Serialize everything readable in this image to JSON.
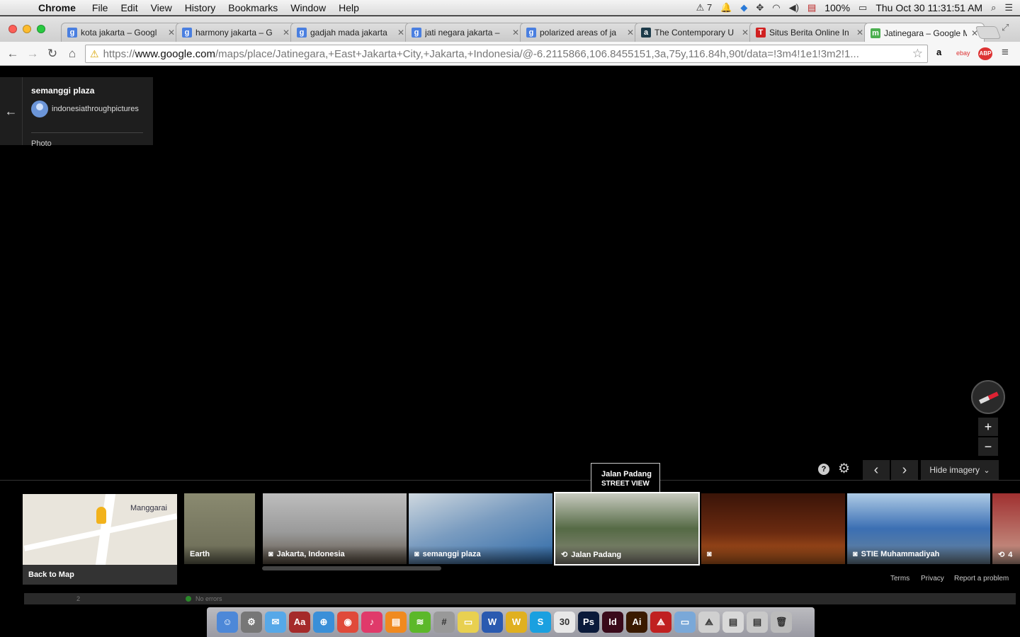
{
  "menubar": {
    "apple": "",
    "app": "Chrome",
    "menus": [
      "File",
      "Edit",
      "View",
      "History",
      "Bookmarks",
      "Window",
      "Help"
    ],
    "adobe_count": "7",
    "battery": "100%",
    "datetime": "Thu Oct 30  11:31:51 AM"
  },
  "tabs": [
    {
      "title": "kota jakarta – Googl",
      "favicon": "g",
      "color": "#4a7fe0"
    },
    {
      "title": "harmony jakarta – G",
      "favicon": "g",
      "color": "#4a7fe0"
    },
    {
      "title": "gadjah mada jakarta",
      "favicon": "g",
      "color": "#4a7fe0"
    },
    {
      "title": "jati negara jakarta –",
      "favicon": "g",
      "color": "#4a7fe0"
    },
    {
      "title": "polarized areas of ja",
      "favicon": "g",
      "color": "#4a7fe0"
    },
    {
      "title": "The Contemporary U",
      "favicon": "a",
      "color": "#1d3b4a"
    },
    {
      "title": "Situs Berita Online In",
      "favicon": "T",
      "color": "#d02020"
    },
    {
      "title": "Jatinegara – Google M",
      "favicon": "m",
      "color": "#4caf50"
    }
  ],
  "address": {
    "scheme": "https://",
    "host": "www.google.com",
    "path": "/maps/place/Jatinegara,+East+Jakarta+City,+Jakarta,+Indonesia/@-6.2115866,106.8455151,3a,75y,116.84h,90t/data=!3m4!1e1!3m2!1..."
  },
  "extensions": {
    "amazon": "a",
    "ebay": "ebay",
    "abp": "ABP"
  },
  "infocard": {
    "title": "semanggi plaza",
    "author": "indonesiathroughpictures",
    "kind": "Photo"
  },
  "controls": {
    "zoom_in": "+",
    "zoom_out": "−",
    "help": "?",
    "settings": "⚙",
    "prev": "‹",
    "next": "›",
    "hide_imagery": "Hide imagery"
  },
  "tooltip": {
    "title": "Jalan Padang",
    "subtitle": "STREET VIEW"
  },
  "mapthumb": {
    "label": "Manggarai",
    "back": "Back to Map"
  },
  "thumbnails": [
    {
      "caption": "Earth",
      "icon": "",
      "bg": "linear-gradient(#8a8a70,#6a6a55)"
    },
    {
      "caption": "Jakarta, Indonesia",
      "icon": "photo-icon",
      "bg": "linear-gradient(#bdbdbd 0%,#9a9a9a 55%,#5e5346 100%)"
    },
    {
      "caption": "semanggi plaza",
      "icon": "photo-icon",
      "bg": "linear-gradient(160deg,#cfd8df 0%,#7a9cc0 45%,#2f6aa8 100%)"
    },
    {
      "caption": "Jalan Padang",
      "icon": "street-view-icon",
      "bg": "linear-gradient(#c8cbc0 0%,#556a45 50%,#8e8b7f 100%)"
    },
    {
      "caption": "",
      "icon": "photo-icon",
      "bg": "linear-gradient(#3a1408 0%,#6a2a10 55%,#c06020 100%)"
    },
    {
      "caption": "STIE Muhammadiyah",
      "icon": "photo-icon",
      "bg": "linear-gradient(#aecbe6 0%,#3b6fb3 50%,#6f8699 100%)"
    },
    {
      "caption": "4",
      "icon": "street-view-icon",
      "bg": "linear-gradient(#a03030,#caa090)"
    }
  ],
  "footer": {
    "terms": "Terms",
    "privacy": "Privacy",
    "report": "Report a problem"
  },
  "devbar": {
    "page": "2",
    "status": "No errors"
  },
  "dock": [
    {
      "name": "finder",
      "label": "☺",
      "color": "#4d88d8"
    },
    {
      "name": "system-prefs",
      "label": "⚙",
      "color": "#777"
    },
    {
      "name": "messages",
      "label": "✉",
      "color": "#56a8e8"
    },
    {
      "name": "dictionary",
      "label": "Aa",
      "color": "#a52a2a"
    },
    {
      "name": "safari",
      "label": "⊕",
      "color": "#3a8fd8"
    },
    {
      "name": "chrome",
      "label": "◉",
      "color": "#e04a3a"
    },
    {
      "name": "itunes",
      "label": "♪",
      "color": "#e03a6a"
    },
    {
      "name": "ibooks",
      "label": "▤",
      "color": "#f08a20"
    },
    {
      "name": "spotify",
      "label": "≋",
      "color": "#5cb82a"
    },
    {
      "name": "calculator",
      "label": "#",
      "color": "#999"
    },
    {
      "name": "stickies",
      "label": "▭",
      "color": "#e8d050"
    },
    {
      "name": "word",
      "label": "W",
      "color": "#2a5ab0"
    },
    {
      "name": "cyberduck",
      "label": "W",
      "color": "#e0b020"
    },
    {
      "name": "skype",
      "label": "S",
      "color": "#1aa0e0"
    },
    {
      "name": "calendar",
      "label": "30",
      "color": "#e8e8e8"
    },
    {
      "name": "photoshop",
      "label": "Ps",
      "color": "#0a1a3a"
    },
    {
      "name": "indesign",
      "label": "Id",
      "color": "#3a0a1a"
    },
    {
      "name": "illustrator",
      "label": "Ai",
      "color": "#3a1a00"
    },
    {
      "name": "acrobat",
      "label": "⟁",
      "color": "#c02020"
    },
    {
      "name": "folder",
      "label": "▭",
      "color": "#7aa8d8"
    },
    {
      "name": "pdf-doc",
      "label": "⟁",
      "color": "#d0d0d0"
    },
    {
      "name": "documents",
      "label": "▤",
      "color": "#d8d8d8"
    },
    {
      "name": "downloads",
      "label": "▤",
      "color": "#c8c8c8"
    },
    {
      "name": "trash",
      "label": "🗑",
      "color": "#bbb"
    }
  ]
}
